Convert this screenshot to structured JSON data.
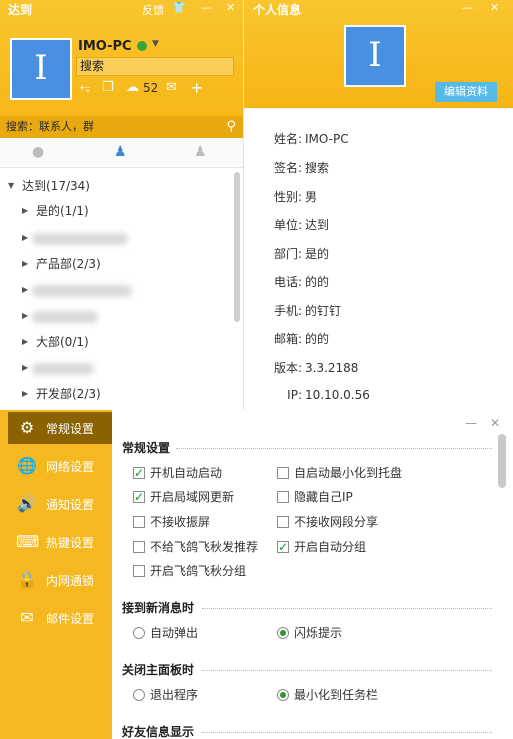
{
  "main": {
    "title": "达到",
    "feedback": "反馈",
    "user": {
      "name": "IMO-PC",
      "avatar_letter": "I",
      "signature": "搜索"
    },
    "toolbar": {
      "count": "52"
    },
    "search_placeholder": "搜索：联系人，群",
    "tree": {
      "root": "达到(17/34)",
      "groups": [
        {
          "label": "是的(1/1)",
          "blurred": false
        },
        {
          "label": "",
          "blurred": true
        },
        {
          "label": "产品部(2/3)",
          "blurred": false
        },
        {
          "label": "",
          "blurred": true
        },
        {
          "label": "",
          "blurred": true
        },
        {
          "label": "大部(0/1)",
          "blurred": false
        },
        {
          "label": "",
          "blurred": true
        },
        {
          "label": "开发部(2/3)",
          "blurred": false
        }
      ]
    }
  },
  "info": {
    "title": "个人信息",
    "avatar_letter": "I",
    "edit_label": "编辑资料",
    "fields": [
      {
        "label": "姓名:",
        "value": "IMO-PC"
      },
      {
        "label": "签名:",
        "value": "搜索"
      },
      {
        "label": "性别:",
        "value": "男"
      },
      {
        "label": "单位:",
        "value": "达到"
      },
      {
        "label": "部门:",
        "value": "是的"
      },
      {
        "label": "电话:",
        "value": "的的"
      },
      {
        "label": "手机:",
        "value": "的钉钉"
      },
      {
        "label": "邮箱:",
        "value": "的的"
      },
      {
        "label": "版本:",
        "value": "3.3.2188"
      },
      {
        "label": "IP:",
        "value": "10.10.0.56"
      }
    ]
  },
  "settings": {
    "nav": [
      {
        "label": "常规设置",
        "icon": "gear-icon",
        "active": true
      },
      {
        "label": "网络设置",
        "icon": "globe-icon",
        "active": false
      },
      {
        "label": "通知设置",
        "icon": "speaker-icon",
        "active": false
      },
      {
        "label": "热键设置",
        "icon": "keyboard-icon",
        "active": false
      },
      {
        "label": "内网通锁",
        "icon": "lock-icon",
        "active": false
      },
      {
        "label": "邮件设置",
        "icon": "mail-icon",
        "active": false
      }
    ],
    "general": {
      "title": "常规设置",
      "checkboxes_left": [
        {
          "label": "开机自动启动",
          "checked": true
        },
        {
          "label": "开启局域网更新",
          "checked": true
        },
        {
          "label": "不接收振屏",
          "checked": false
        },
        {
          "label": "不给飞鸽飞秋发推荐",
          "checked": false
        },
        {
          "label": "开启飞鸽飞秋分组",
          "checked": false
        }
      ],
      "checkboxes_right": [
        {
          "label": "自启动最小化到托盘",
          "checked": false
        },
        {
          "label": "隐藏自己IP",
          "checked": false
        },
        {
          "label": "不接收网段分享",
          "checked": false
        },
        {
          "label": "开启自动分组",
          "checked": true
        }
      ]
    },
    "new_message": {
      "title": "接到新消息时",
      "options": [
        {
          "label": "自动弹出",
          "selected": false
        },
        {
          "label": "闪烁提示",
          "selected": true
        }
      ]
    },
    "close_panel": {
      "title": "关闭主面板时",
      "options": [
        {
          "label": "退出程序",
          "selected": false
        },
        {
          "label": "最小化到任务栏",
          "selected": true
        }
      ]
    },
    "friend_display": {
      "title": "好友信息显示"
    }
  },
  "colors": {
    "accent": "#f6b820",
    "nav_active": "#8a6200",
    "link_blue": "#57b9e8",
    "avatar": "#4a90e2"
  }
}
